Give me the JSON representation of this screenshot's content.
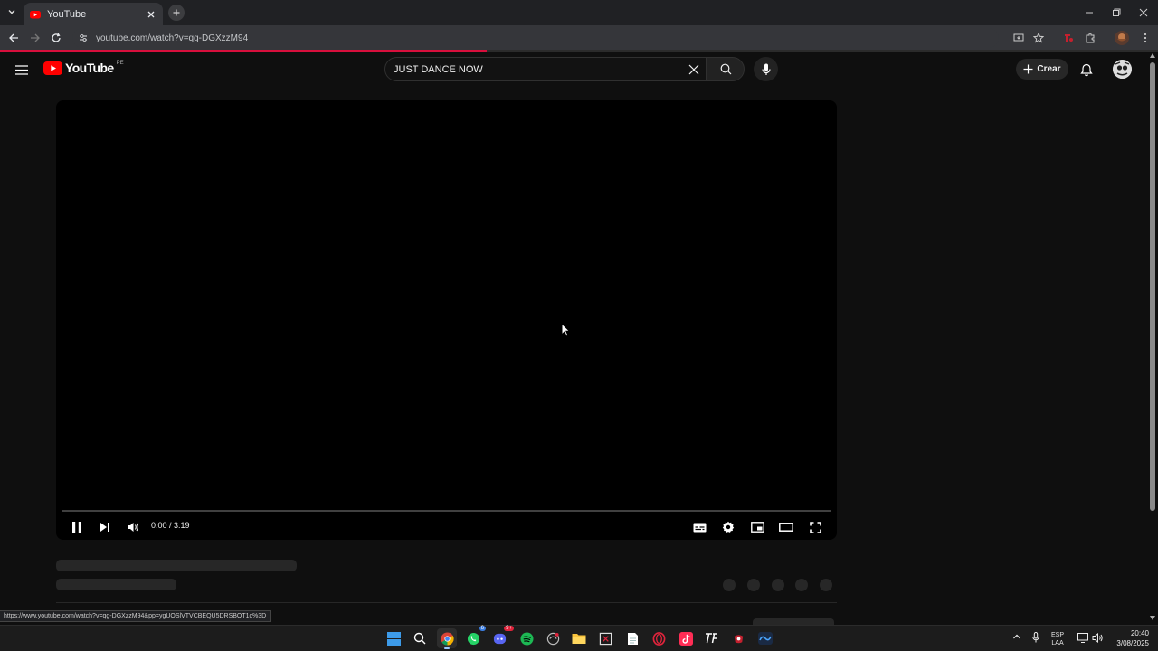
{
  "browser": {
    "tab_title": "YouTube",
    "url": "youtube.com/watch?v=qg-DGXzzM94",
    "status_link": "https://www.youtube.com/watch?v=qg-DGXzzM94&pp=ygUOSlVTVCBEQU5DRSBOT1c%3D",
    "load_progress": 0.42
  },
  "header": {
    "logo_text": "YouTube",
    "region": "PE",
    "search_value": "JUST DANCE NOW",
    "create_label": "Crear"
  },
  "player": {
    "time_display": "0:00 / 3:19",
    "progress": 0.0,
    "state": "playing"
  },
  "taskbar": {
    "language": "ESP",
    "layout": "LAA",
    "time": "20:40",
    "date": "3/08/2025",
    "whatsapp_badge": "6",
    "discord_badge": "9+"
  },
  "colors": {
    "youtube_red": "#ff0000",
    "background": "#0f0f0f",
    "load_bar": "#d80f3c"
  }
}
